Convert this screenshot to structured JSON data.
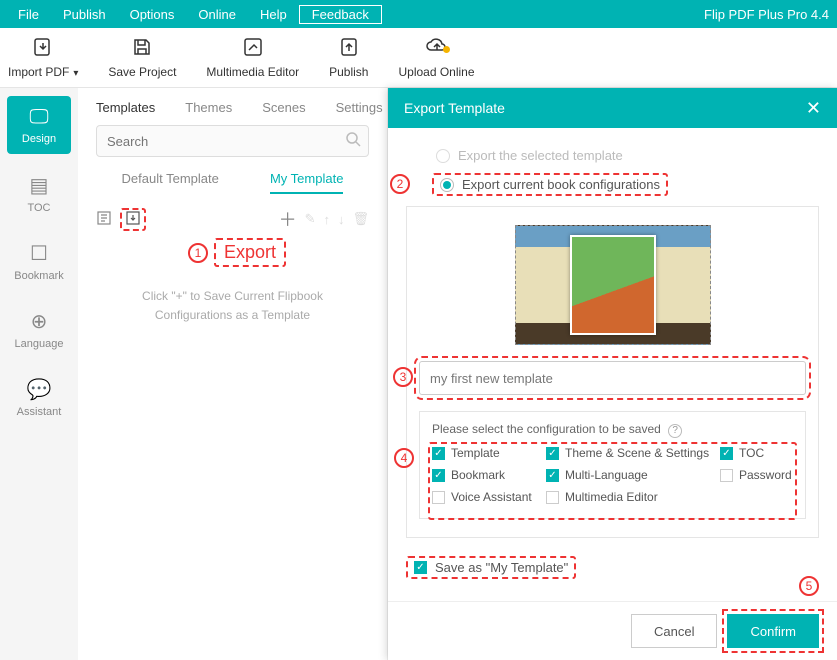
{
  "app": {
    "title": "Flip PDF Plus Pro 4.4"
  },
  "menu": {
    "file": "File",
    "publish": "Publish",
    "options": "Options",
    "online": "Online",
    "help": "Help",
    "feedback": "Feedback"
  },
  "toolbar": {
    "import": "Import PDF",
    "save": "Save Project",
    "multimedia": "Multimedia Editor",
    "publish": "Publish",
    "upload": "Upload Online"
  },
  "leftnav": {
    "design": "Design",
    "toc": "TOC",
    "bookmark": "Bookmark",
    "language": "Language",
    "assistant": "Assistant"
  },
  "panel": {
    "tabs": {
      "templates": "Templates",
      "themes": "Themes",
      "scenes": "Scenes",
      "settings": "Settings"
    },
    "search_placeholder": "Search",
    "subtabs": {
      "default": "Default Template",
      "my": "My Template"
    },
    "annot": {
      "num": "1",
      "label": "Export"
    },
    "hint": "Click \"+\" to Save Current Flipbook Configurations as a Template"
  },
  "dialog": {
    "title": "Export Template",
    "opt_selected": "Export the selected template",
    "opt_current": "Export current book configurations",
    "name_value": "my first new template",
    "config_title": "Please select the configuration to be saved",
    "checks": {
      "template": "Template",
      "theme": "Theme & Scene & Settings",
      "toc": "TOC",
      "bookmark": "Bookmark",
      "multilang": "Multi-Language",
      "password": "Password",
      "voice": "Voice Assistant",
      "mme": "Multimedia Editor"
    },
    "saveas": "Save as \"My Template\"",
    "cancel": "Cancel",
    "confirm": "Confirm",
    "annot": {
      "n2": "2",
      "n3": "3",
      "n4": "4",
      "n5": "5"
    }
  }
}
